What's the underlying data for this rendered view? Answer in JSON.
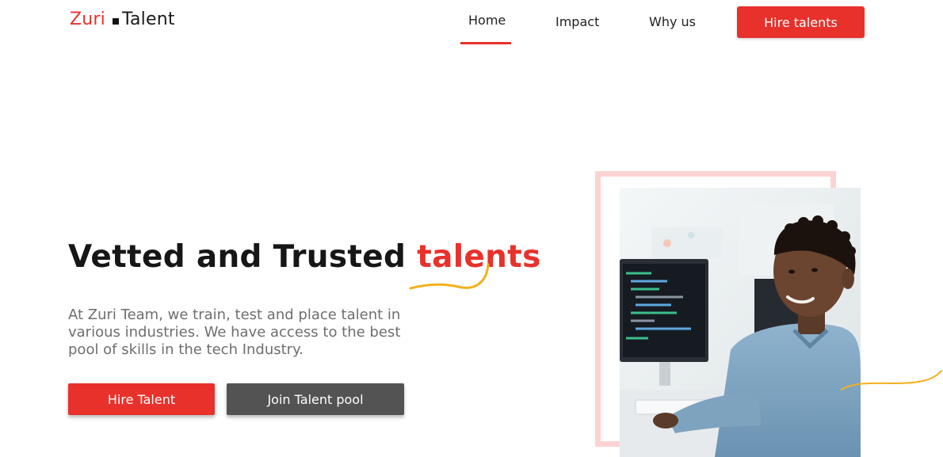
{
  "header": {
    "logo_part1": "Zuri",
    "logo_part2": "Talent",
    "nav": {
      "home": "Home",
      "impact": "Impact",
      "why_us": "Why us"
    },
    "cta": "Hire talents"
  },
  "hero": {
    "headline_main": "Vetted and Trusted",
    "headline_accent": "talents",
    "description": "At Zuri Team, we train, test and place talent in various industries. We have access to the best pool of skills in the tech Industry.",
    "primary_button": "Hire Talent",
    "secondary_button": "Join Talent pool"
  },
  "colors": {
    "brand_red": "#e8312b",
    "accent_yellow": "#f2b01e",
    "frame_pink": "#fbd4d2",
    "button_gray": "#535353"
  }
}
